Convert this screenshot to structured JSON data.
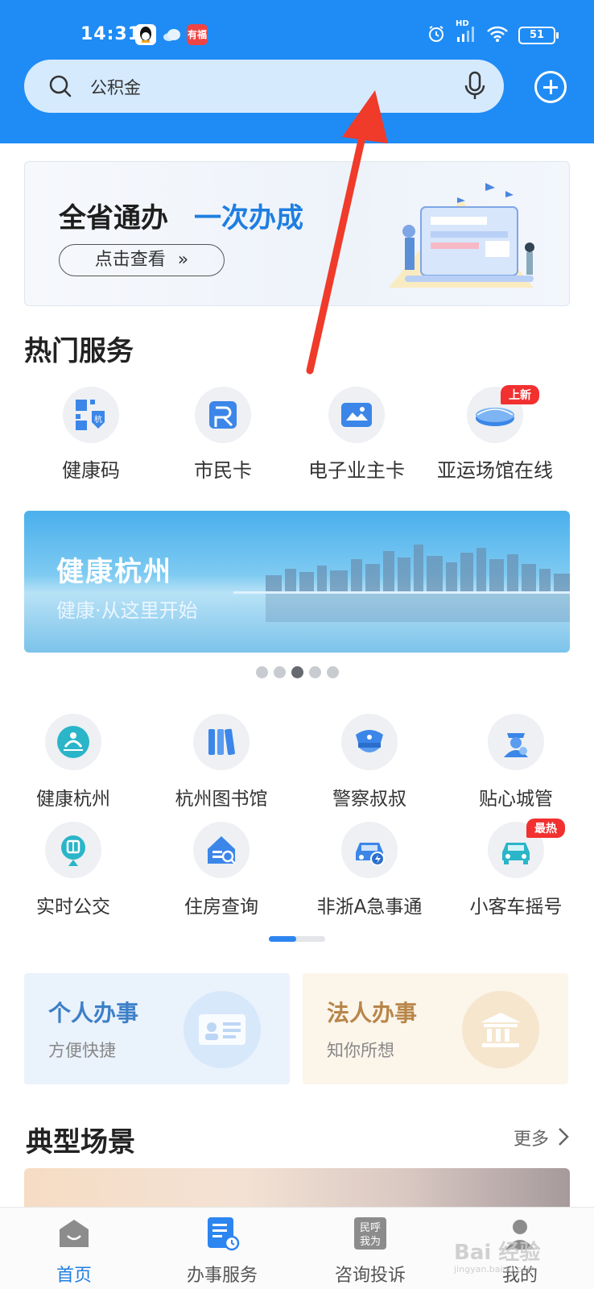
{
  "status_bar": {
    "time": "14:31",
    "app_icons": [
      "qq-icon",
      "cloud-icon",
      "news-app-icon"
    ],
    "news_app_label": "有福",
    "network_label": "HD",
    "battery": "51"
  },
  "search": {
    "placeholder": "公积金",
    "icon": "search-icon",
    "voice_icon": "microphone-icon",
    "add_icon": "plus-circle-icon"
  },
  "promo_banner": {
    "title_part1": "全省通办",
    "title_part2": "一次办成",
    "button_label": "点击查看",
    "button_icon": "double-chevron-right-icon",
    "colors": {
      "title": "#1e1e1e",
      "highlight": "#1f7ee0"
    }
  },
  "hot_services": {
    "title": "热门服务",
    "items": [
      {
        "label": "健康码",
        "icon": "health-code-icon"
      },
      {
        "label": "市民卡",
        "icon": "citizen-card-icon"
      },
      {
        "label": "电子业主卡",
        "icon": "owner-card-icon"
      },
      {
        "label": "亚运场馆在线",
        "icon": "stadium-icon",
        "badge": "上新"
      }
    ]
  },
  "city_banner": {
    "title": "健康杭州",
    "subtitle": "健康·从这里开始",
    "pages": 5,
    "active_page": 3
  },
  "service_grid": {
    "items": [
      {
        "label": "健康杭州",
        "icon": "healthy-hangzhou-icon"
      },
      {
        "label": "杭州图书馆",
        "icon": "library-books-icon"
      },
      {
        "label": "警察叔叔",
        "icon": "police-cap-icon"
      },
      {
        "label": "贴心城管",
        "icon": "city-officer-icon"
      },
      {
        "label": "实时公交",
        "icon": "bus-stop-icon"
      },
      {
        "label": "住房查询",
        "icon": "house-search-icon"
      },
      {
        "label": "非浙A急事通",
        "icon": "car-flash-icon"
      },
      {
        "label": "小客车摇号",
        "icon": "car-icon",
        "badge": "最热"
      }
    ],
    "pages": 2,
    "active_page": 1
  },
  "affairs": {
    "personal": {
      "title": "个人办事",
      "subtitle": "方便快捷",
      "icon": "id-card-icon",
      "color": "#3d7fc7",
      "bg": "#eaf2fc"
    },
    "legal": {
      "title": "法人办事",
      "subtitle": "知你所想",
      "icon": "government-building-icon",
      "color": "#b8864a",
      "bg": "#fcf5ea"
    }
  },
  "scenes": {
    "title": "典型场景",
    "more_label": "更多"
  },
  "tabbar": {
    "items": [
      {
        "label": "首页",
        "icon": "home-icon",
        "active": true
      },
      {
        "label": "办事服务",
        "icon": "service-doc-icon",
        "active": false
      },
      {
        "label": "咨询投诉",
        "icon": "consult-icon",
        "icon_text": "民呼\n我为",
        "active": false
      },
      {
        "label": "我的",
        "icon": "user-icon",
        "active": false
      }
    ]
  },
  "watermark": {
    "text": "Bai 经验",
    "url": "jingyan.baidu.com"
  },
  "annotation": {
    "icon": "red-arrow-icon",
    "color": "#f03a2a"
  }
}
